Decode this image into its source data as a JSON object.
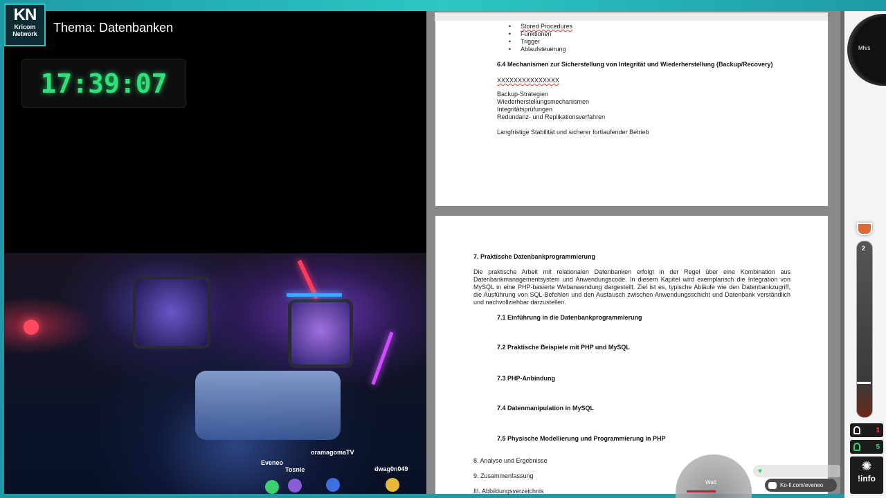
{
  "overlay": {
    "logo_main": "KN",
    "logo_sub1": "Kricom",
    "logo_sub2": "Network",
    "topic": "Thema: Datenbanken",
    "clock": "17:39:07"
  },
  "viewers": [
    {
      "name": "Eveneo",
      "color": "#3bd16f"
    },
    {
      "name": "Tosnie",
      "color": "#8a5cd6"
    },
    {
      "name": "oramagomaTV",
      "color": "#3c6fe0"
    },
    {
      "name": "dwag0n049",
      "color": "#e8b93a"
    }
  ],
  "document": {
    "page1": {
      "bullets": [
        "Stored Procedures",
        "Funktionen",
        "Trigger",
        "Ablaufsteuerung"
      ],
      "heading": "6.4 Mechanismen zur Sicherstellung von Integrität und Wiederherstellung (Backup/Recovery)",
      "placeholder": "XXXXXXXXXXXXXXX",
      "lines": [
        "Backup-Strategien",
        "Wiederherstellungsmechanismen",
        "Integritätsprüfungen",
        "Redundanz- und Replikationsverfahren"
      ],
      "closing": "Langfristige Stabilität und sicherer fortlaufender Betrieb"
    },
    "page2": {
      "heading": "7. Praktische Datenbankprogrammierung",
      "paragraph": "Die praktische Arbeit mit relationalen Datenbanken erfolgt in der Regel über eine Kombination aus Datenbankmanagementsystem und Anwendungscode. In diesem Kapitel wird exemplarisch die Integration von MySQL in eine PHP-basierte Webanwendung dargestellt. Ziel ist es, typische Abläufe wie den Datenbankzugriff, die Ausführung von SQL-Befehlen und den Austausch zwischen Anwendungsschicht und Datenbank verständlich und nachvollziehbar darzustellen.",
      "subsections": [
        "7.1 Einführung in die Datenbankprogrammierung",
        "7.2 Praktische Beispiele mit PHP und MySQL",
        "7.3 PHP-Anbindung",
        "7.4 Datenmanipulation in MySQL",
        "7.5 Physische Modellierung und Programmierung in PHP"
      ],
      "chapters": [
        "8. Analyse und Ergebnisse",
        "9. Zusammenfassung",
        "III. Abbildungsverzeichnis"
      ]
    }
  },
  "widgets": {
    "gauge_label": "Watt",
    "kofi": "Ko-fi.com/eveneo",
    "speed_unit": "Mh/s",
    "tube_value": "2",
    "viewers_count": "1",
    "chatters_count": "5",
    "info_label": "!info"
  }
}
